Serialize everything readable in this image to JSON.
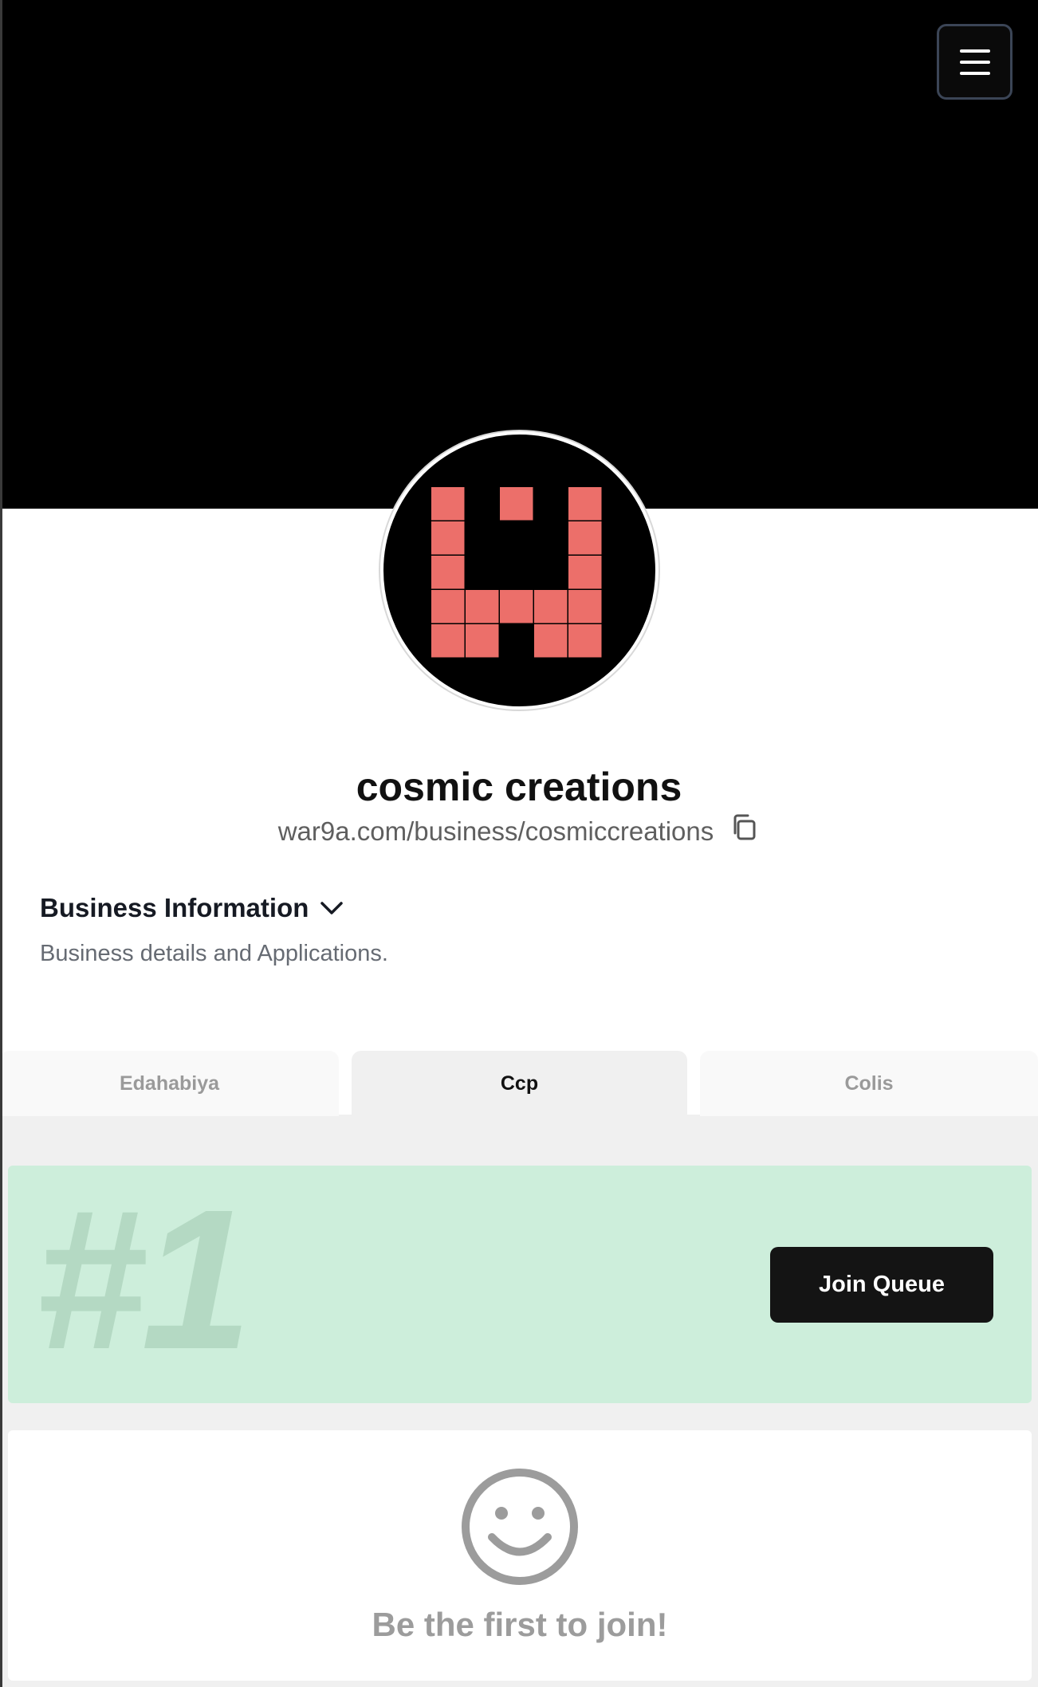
{
  "header": {
    "menu_icon": "hamburger-menu-icon",
    "banner_color": "#000000"
  },
  "profile": {
    "logo_colors": {
      "background": "#000000",
      "tiles": "#ec6f6a"
    },
    "name": "cosmic creations",
    "url": "war9a.com/business/cosmiccreations",
    "copy_icon": "copy-icon"
  },
  "business_info": {
    "title": "Business Information",
    "description": "Business details and Applications.",
    "toggle_icon": "chevron-down-icon"
  },
  "tabs": [
    {
      "label": "Edahabiya",
      "active": false
    },
    {
      "label": "Ccp",
      "active": true
    },
    {
      "label": "Colis",
      "active": false
    }
  ],
  "queue": {
    "position": "#1",
    "join_label": "Join Queue",
    "card_color": "#cdeedb",
    "empty_icon": "smiley-face-icon",
    "empty_message": "Be the first to join!"
  }
}
